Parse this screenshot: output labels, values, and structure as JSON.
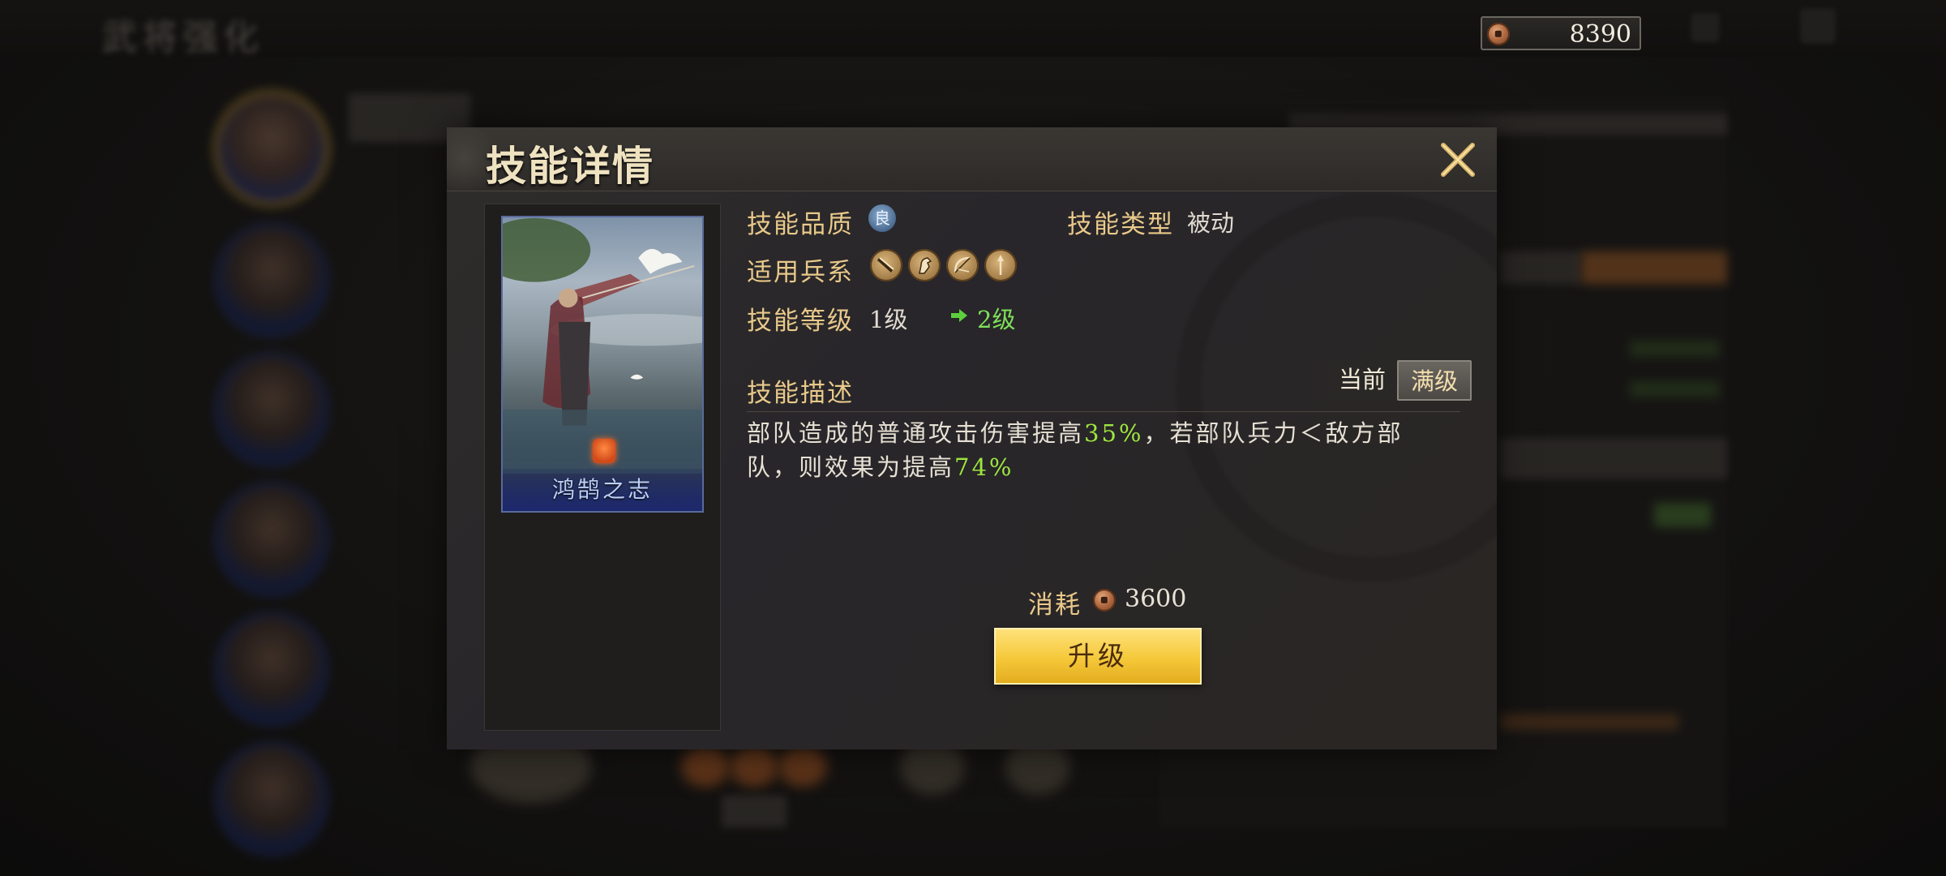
{
  "background": {
    "title": "武将强化"
  },
  "currency": {
    "icon": "copper-coin-icon",
    "amount": "8390"
  },
  "modal": {
    "title": "技能详情",
    "card": {
      "name": "鸿鹄之志"
    },
    "quality": {
      "label": "技能品质",
      "badge": "良"
    },
    "type": {
      "label": "技能类型",
      "value": "被动"
    },
    "troops": {
      "label": "适用兵系",
      "icons": [
        "blade-icon",
        "horse-icon",
        "bow-icon",
        "spear-icon"
      ]
    },
    "level": {
      "label": "技能等级",
      "current": "1级",
      "next": "2级"
    },
    "description": {
      "label": "技能描述",
      "tabs": [
        "当前",
        "满级"
      ],
      "selected_tab": "满级",
      "text_parts": [
        "部队造成的普通攻击伤害提高",
        "35%",
        "，若部队兵力＜敌方部队，则效果为提高",
        "74%"
      ]
    },
    "cost": {
      "label": "消耗",
      "icon": "copper-coin-icon",
      "value": "3600"
    },
    "upgrade_button": "升级",
    "colors": {
      "label_gold": "#e9c98a",
      "highlight_green": "#9ee640",
      "button_yellow": "#f5c83a"
    }
  }
}
